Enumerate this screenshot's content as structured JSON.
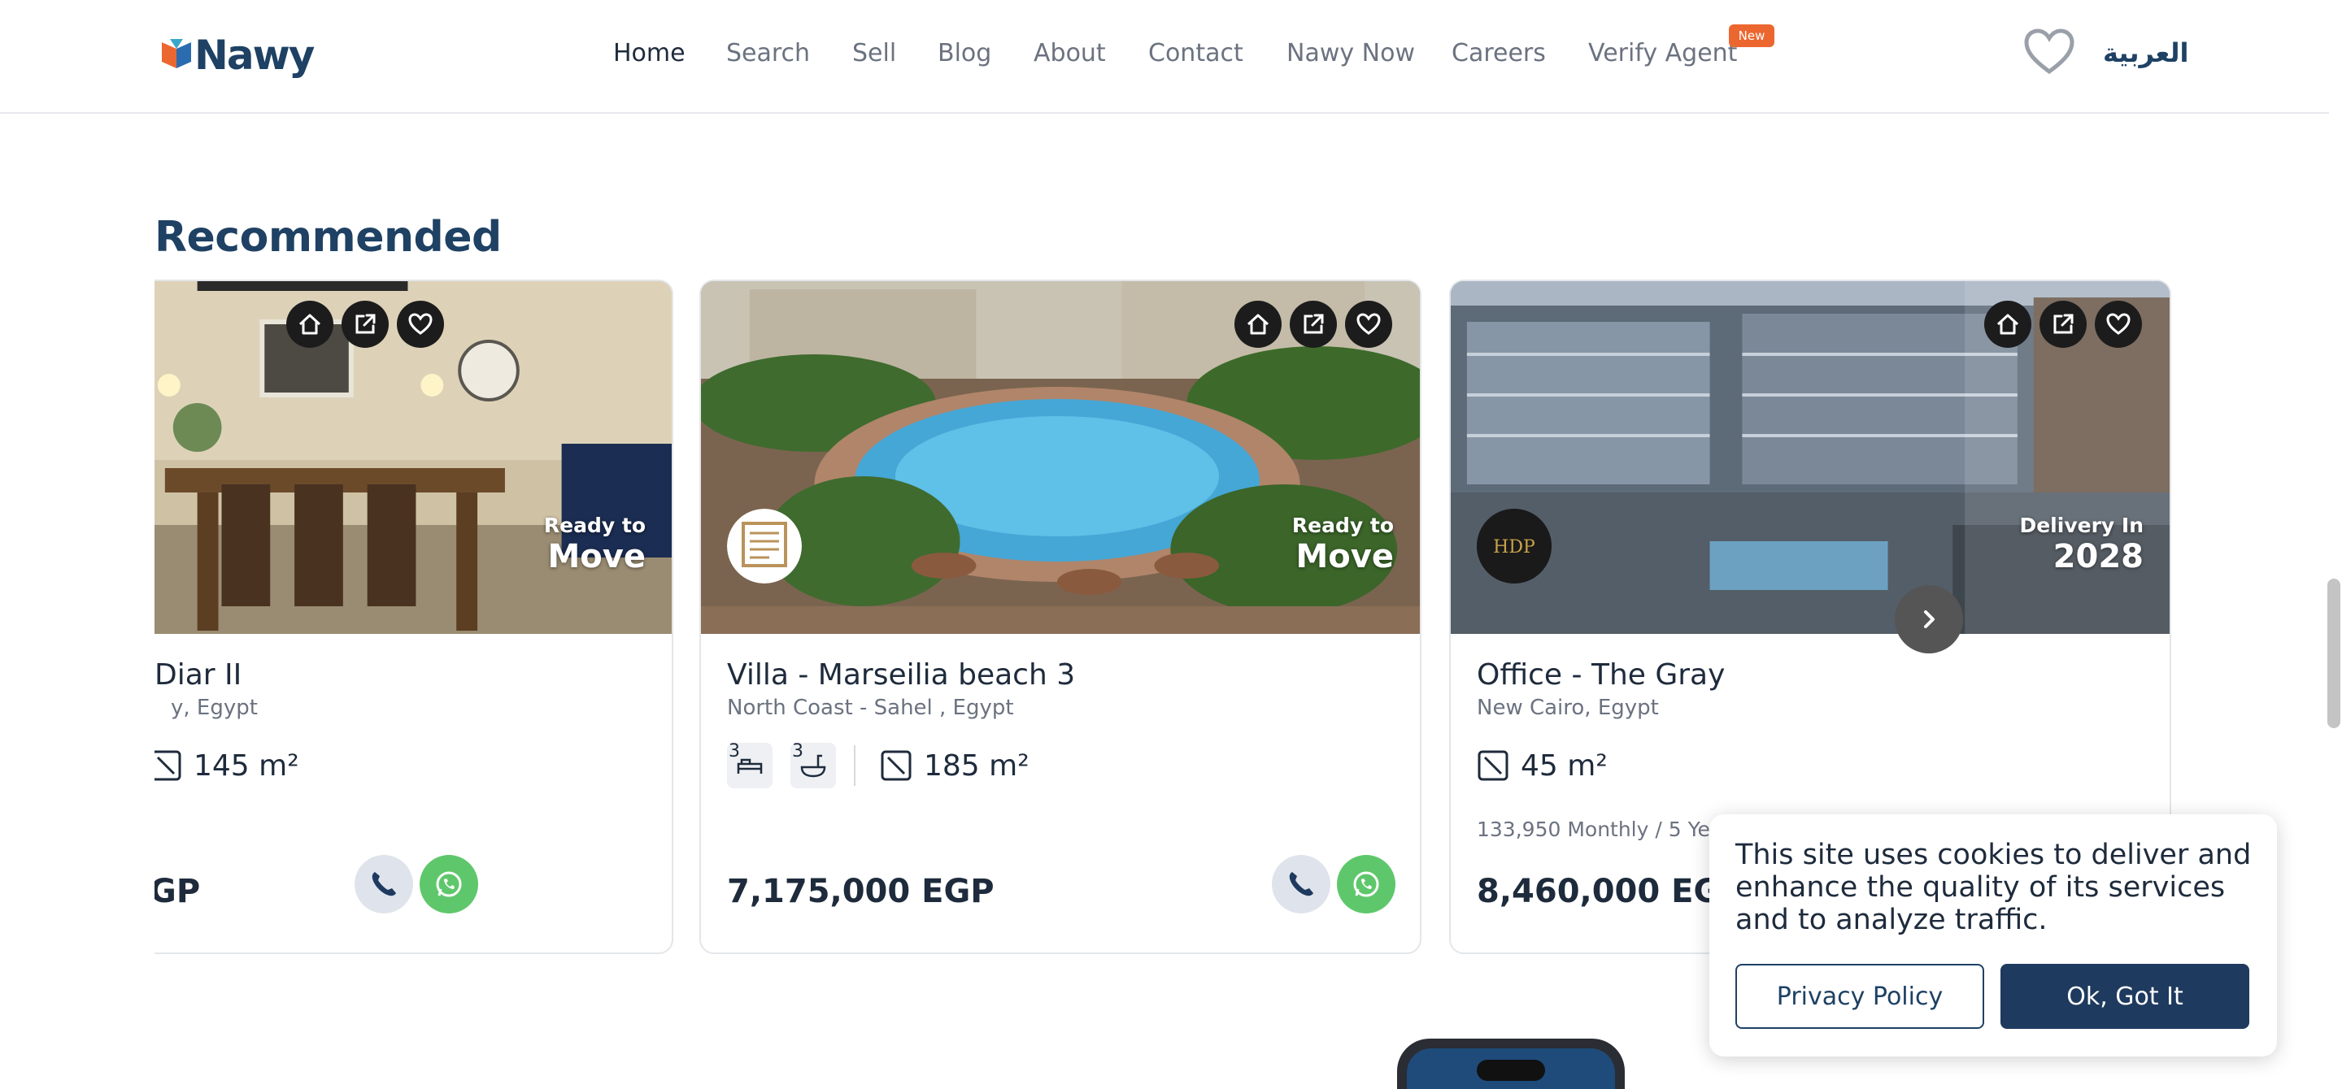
{
  "header": {
    "logo_text": "Nawy",
    "nav": [
      {
        "label": "Home",
        "active": true
      },
      {
        "label": "Search"
      },
      {
        "label": "Sell"
      },
      {
        "label": "Blog"
      },
      {
        "label": "About"
      },
      {
        "label": "Contact"
      },
      {
        "label": "Nawy Now"
      },
      {
        "label": "Careers"
      },
      {
        "label": "Verify Agent"
      }
    ],
    "new_badge": "New",
    "language": "العربية",
    "favorites_icon": "heart-icon"
  },
  "section": {
    "title": "Recommended",
    "cards": [
      {
        "title": "Diar II",
        "location": "y, Egypt",
        "area": "145 m²",
        "price": "GP",
        "status_small": "Ready to",
        "status_big": "Move"
      },
      {
        "title": "Villa - Marseilia beach 3",
        "location": "North Coast - Sahel , Egypt",
        "beds": "3",
        "baths": "3",
        "area": "185 m²",
        "price": "7,175,000 EGP",
        "status_small": "Ready to",
        "status_big": "Move"
      },
      {
        "title": "Office - The Gray",
        "location": "New Cairo, Egypt",
        "area": "45 m²",
        "monthly": "133,950 Monthly / 5 Years",
        "price": "8,460,000 EGP",
        "status_small": "Delivery In",
        "status_big": "2028",
        "developer_logo_text": "HDP"
      }
    ]
  },
  "cookie": {
    "message": "This site uses cookies to deliver and enhance the quality of its services and to analyze traffic.",
    "privacy_label": "Privacy Policy",
    "ok_label": "Ok, Got It"
  },
  "colors": {
    "brand_navy": "#1e4164",
    "accent_orange": "#ec6730",
    "whatsapp_green": "#5fc76b"
  }
}
